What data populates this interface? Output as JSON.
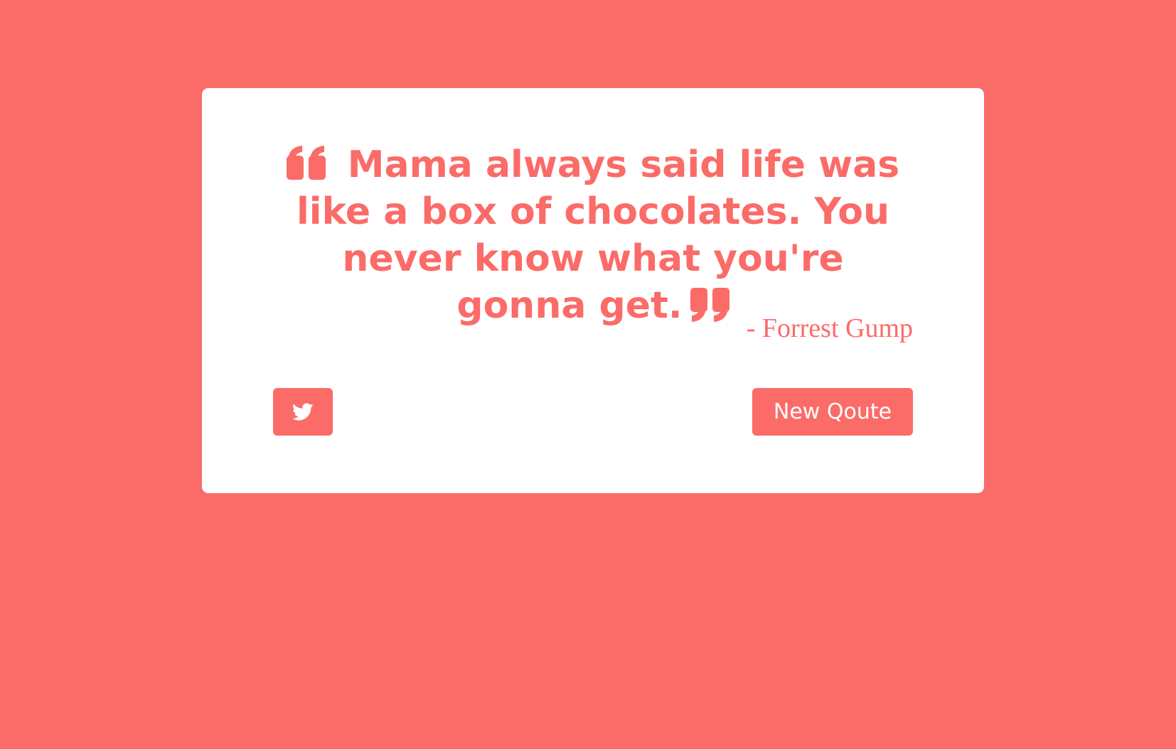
{
  "quote": {
    "text": "Mama always said life was like a box of chocolates. You never know what you're gonna get.",
    "author": "- Forrest Gump"
  },
  "buttons": {
    "new_quote_label": "New Qoute",
    "tweet_icon": "twitter-icon"
  },
  "colors": {
    "accent": "#fb6b68",
    "card": "#ffffff"
  }
}
